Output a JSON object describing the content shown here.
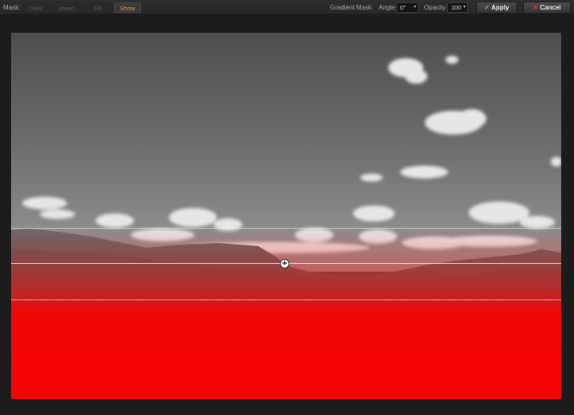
{
  "toolbar": {
    "mask_label": "Mask:",
    "clear": "Clear",
    "invert": "Invert",
    "fill": "Fill",
    "show": "Show",
    "gradient_label": "Gradient Mask:",
    "angle_label": "Angle",
    "angle_value": "0°",
    "opacity_label": "Opacity",
    "opacity_value": "100",
    "apply": "Apply",
    "cancel": "Cancel"
  },
  "icons": {
    "apply": "check-icon",
    "cancel": "x-icon",
    "handle": "move-crosshair-icon",
    "dropdown": "chevron-down-icon"
  },
  "colors": {
    "mask": "#ff0000",
    "active_button_text": "#d49c45",
    "apply_check": "#7fd14a",
    "cancel_x": "#e23a3a"
  },
  "gradient_mask": {
    "angle_degrees": 0,
    "opacity_percent": 100
  }
}
